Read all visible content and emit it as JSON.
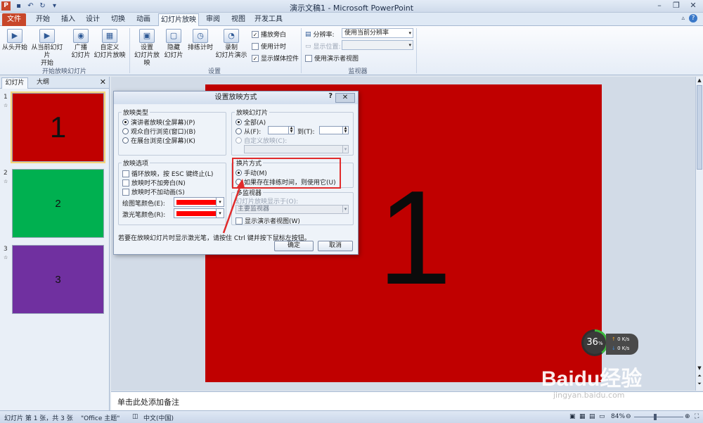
{
  "window": {
    "title": "演示文稿1 - Microsoft PowerPoint",
    "app_icon": "P"
  },
  "tabs": [
    "文件",
    "开始",
    "插入",
    "设计",
    "切换",
    "动画",
    "幻灯片放映",
    "审阅",
    "视图",
    "开发工具"
  ],
  "ribbon": {
    "start_group": {
      "label": "开始放映幻灯片",
      "from_start": "从头开始",
      "from_current_1": "从当前幻灯片",
      "from_current_2": "开始",
      "broadcast_1": "广播",
      "broadcast_2": "幻灯片",
      "custom_1": "自定义",
      "custom_2": "幻灯片放映"
    },
    "setup_group": {
      "label": "设置",
      "setup_1": "设置",
      "setup_2": "幻灯片放映",
      "hide_1": "隐藏",
      "hide_2": "幻灯片",
      "rehearse": "排练计时",
      "record_1": "录制",
      "record_2": "幻灯片演示",
      "play_narration": "播放旁白",
      "use_timing": "使用计时",
      "show_media": "显示媒体控件"
    },
    "monitor_group": {
      "label": "监视器",
      "resolution_label": "分辨率:",
      "resolution_value": "使用当前分辨率",
      "display_on_label": "显示位置:",
      "presenter_view": "使用演示者视图"
    }
  },
  "left_pane": {
    "tab_slides": "幻灯片",
    "tab_outline": "大纲",
    "thumbs": [
      {
        "num": "1",
        "label": "1",
        "color": "#c00000"
      },
      {
        "num": "2",
        "label": "2",
        "color": "#00b050"
      },
      {
        "num": "3",
        "label": "3",
        "color": "#7030a0"
      }
    ]
  },
  "slide": {
    "text": "1",
    "color": "#c00000"
  },
  "notes_placeholder": "单击此处添加备注",
  "status": {
    "slide_info": "幻灯片 第 1 张，共 3 张",
    "theme": "\"Office 主题\"",
    "language": "中文(中国)",
    "zoom": "84%"
  },
  "dialog": {
    "title": "设置放映方式",
    "help": "?",
    "show_type": {
      "legend": "放映类型",
      "opt1": "演讲者放映(全屏幕)(P)",
      "opt2": "观众自行浏览(窗口)(B)",
      "opt3": "在展台浏览(全屏幕)(K)"
    },
    "show_slides": {
      "legend": "放映幻灯片",
      "all": "全部(A)",
      "from": "从(F):",
      "to": "到(T):",
      "custom": "自定义放映(C):"
    },
    "show_options": {
      "legend": "放映选项",
      "loop": "循环放映，按 ESC 键终止(L)",
      "no_narration": "放映时不加旁白(N)",
      "no_animation": "放映时不加动画(S)",
      "pen_color": "绘图笔颜色(E):",
      "laser_color": "激光笔颜色(R):"
    },
    "advance": {
      "legend": "换片方式",
      "manual": "手动(M)",
      "timings": "如果存在排练时间，则使用它(U)"
    },
    "monitors": {
      "legend": "多监视器",
      "display_on": "幻灯片放映显示于(O):",
      "display_value": "主要监视器",
      "presenter_view": "显示演示者视图(W)"
    },
    "hint": "若要在放映幻灯片时显示激光笔，请按住 Ctrl 键并按下鼠标左按钮。",
    "ok": "确定",
    "cancel": "取消"
  },
  "overlay": {
    "cpu": "36",
    "cpu_unit": "%",
    "up_speed": "0 K/s",
    "down_speed": "0 K/s",
    "watermark": "Baidu经验",
    "watermark_url": "jingyan.baidu.com"
  }
}
